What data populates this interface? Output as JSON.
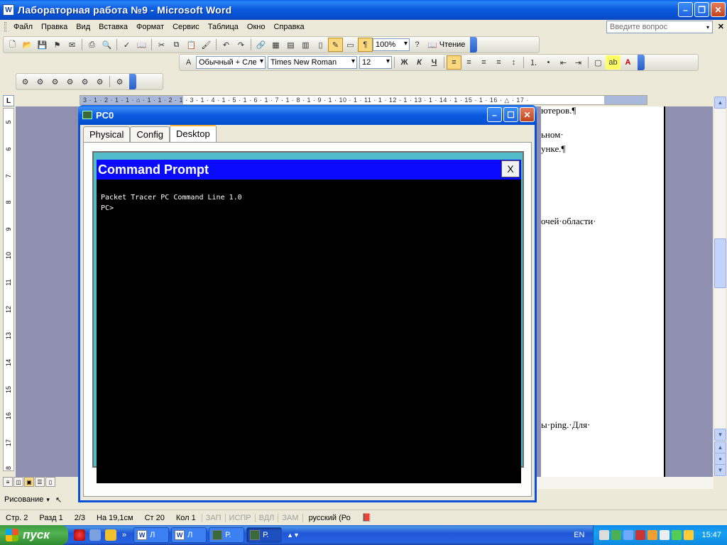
{
  "word": {
    "title": "Лабораторная работа №9 - Microsoft Word",
    "menu": [
      "Файл",
      "Правка",
      "Вид",
      "Вставка",
      "Формат",
      "Сервис",
      "Таблица",
      "Окно",
      "Справка"
    ],
    "ask_placeholder": "Введите вопрос",
    "standard_toolbar": {
      "zoom": "100%",
      "reading_label": "Чтение"
    },
    "formatting_toolbar": {
      "style": "Обычный + Сле",
      "font": "Times New Roman",
      "size": "12"
    },
    "ruler_marks": "3 · 1 · 2 · 1 · 1 · ⌂ · 1 · 1 · 2 · 1 · 3 · 1 · 4 · 1 · 5 · 1 · 6 · 1 · 7 · 1 · 8 · 1 · 9 · 1 · 10 · 1 · 11 · 1 · 12 · 1 · 13 · 1 · 14 · 1 · 15 · 1 · 16 · △ · 17 ·",
    "vruler_numbers": [
      "5",
      "6",
      "7",
      "8",
      "9",
      "10",
      "11",
      "12",
      "13",
      "14",
      "15",
      "16",
      "17",
      "18"
    ],
    "page_fragments": [
      "ютеров.¶",
      "ьном·",
      "унке.¶",
      "очей·области·",
      "ы·ping.·Для·"
    ],
    "drawing_label": "Рисование",
    "status": {
      "page": "Стр. 2",
      "section": "Разд 1",
      "pages": "2/3",
      "at": "На 19,1см",
      "line": "Ст 20",
      "col": "Кол 1",
      "rec": "ЗАП",
      "trk": "ИСПР",
      "ext": "ВДЛ",
      "ovr": "ЗАМ",
      "language": "русский (Ро"
    }
  },
  "pc_window": {
    "title": "PC0",
    "tabs": [
      "Physical",
      "Config",
      "Desktop"
    ],
    "active_tab": "Desktop",
    "command_prompt": {
      "title": "Command Prompt",
      "close_label": "X",
      "lines": [
        "Packet Tracer PC Command Line 1.0",
        "PC>"
      ]
    }
  },
  "taskbar": {
    "start_label": "пуск",
    "tasks": [
      {
        "label": "Л",
        "icon": "word-icon"
      },
      {
        "label": "Л",
        "icon": "word-icon"
      },
      {
        "label": "Р.",
        "icon": "packet-tracer-icon"
      },
      {
        "label": "Р.",
        "icon": "packet-tracer-icon"
      }
    ],
    "language": "EN",
    "clock": "15:47"
  },
  "colors": {
    "xp_blue": "#0a5fe8",
    "cmd_titlebar": "#0a0aff",
    "desktop_teal": "#53bccb",
    "doc_background": "#8f8faf",
    "start_green": "#3c9a3c"
  }
}
